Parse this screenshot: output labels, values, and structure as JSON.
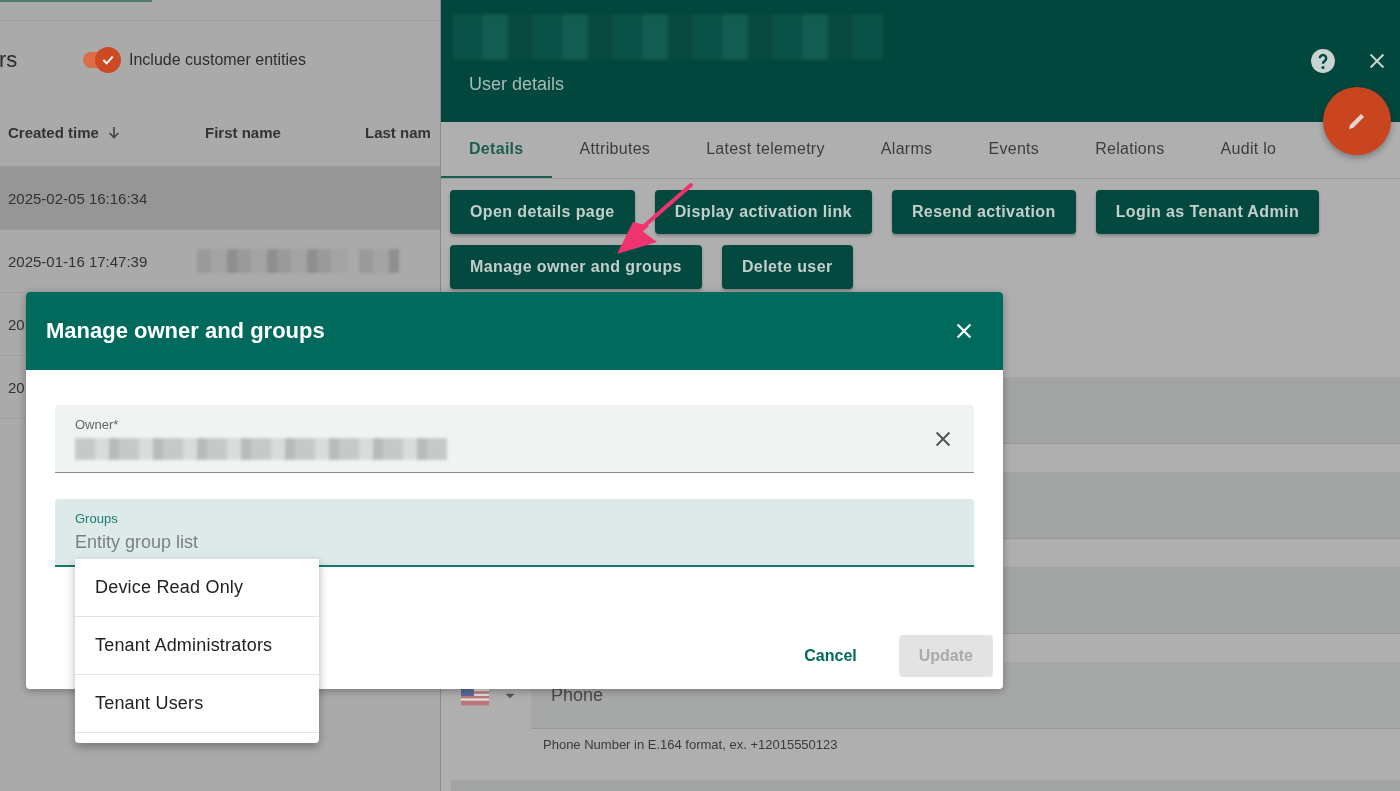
{
  "users_panel": {
    "title": "rs",
    "toggle": {
      "label": "Include customer entities",
      "on": true
    }
  },
  "table": {
    "columns": [
      {
        "label": "Created time",
        "sorted": true
      },
      {
        "label": "First name",
        "sorted": false
      },
      {
        "label": "Last nam",
        "sorted": false
      }
    ],
    "rows": [
      {
        "created": "2025-02-05 16:16:34",
        "selected": true,
        "redacted": false
      },
      {
        "created": "2025-01-16 17:47:39",
        "selected": false,
        "redacted": true
      },
      {
        "created": "20"
      },
      {
        "created": "20"
      }
    ]
  },
  "drawer": {
    "subtitle": "User details",
    "tabs": [
      {
        "label": "Details",
        "selected": true
      },
      {
        "label": "Attributes",
        "selected": false
      },
      {
        "label": "Latest telemetry",
        "selected": false
      },
      {
        "label": "Alarms",
        "selected": false
      },
      {
        "label": "Events",
        "selected": false
      },
      {
        "label": "Relations",
        "selected": false
      },
      {
        "label": "Audit lo",
        "selected": false
      }
    ],
    "actions": [
      [
        "Open details page",
        "Display activation link",
        "Resend activation",
        "Login as Tenant Admin"
      ],
      [
        "Manage owner and groups",
        "Delete user"
      ]
    ],
    "fields": [
      {
        "kind": "blank"
      },
      {
        "kind": "blank"
      },
      {
        "kind": "blank"
      },
      {
        "kind": "phone",
        "placeholder": "Phone",
        "hint": "Phone Number in E.164 format, ex. +12015550123"
      },
      {
        "kind": "blank"
      }
    ]
  },
  "dialog": {
    "title": "Manage owner and groups",
    "owner": {
      "label": "Owner*"
    },
    "groups": {
      "label": "Groups",
      "placeholder": "Entity group list",
      "focused": true
    },
    "menu": [
      "Device Read Only",
      "Tenant Administrators",
      "Tenant Users"
    ],
    "buttons": [
      {
        "label": "Cancel",
        "disabled": false
      },
      {
        "label": "Update",
        "disabled": true
      }
    ]
  }
}
